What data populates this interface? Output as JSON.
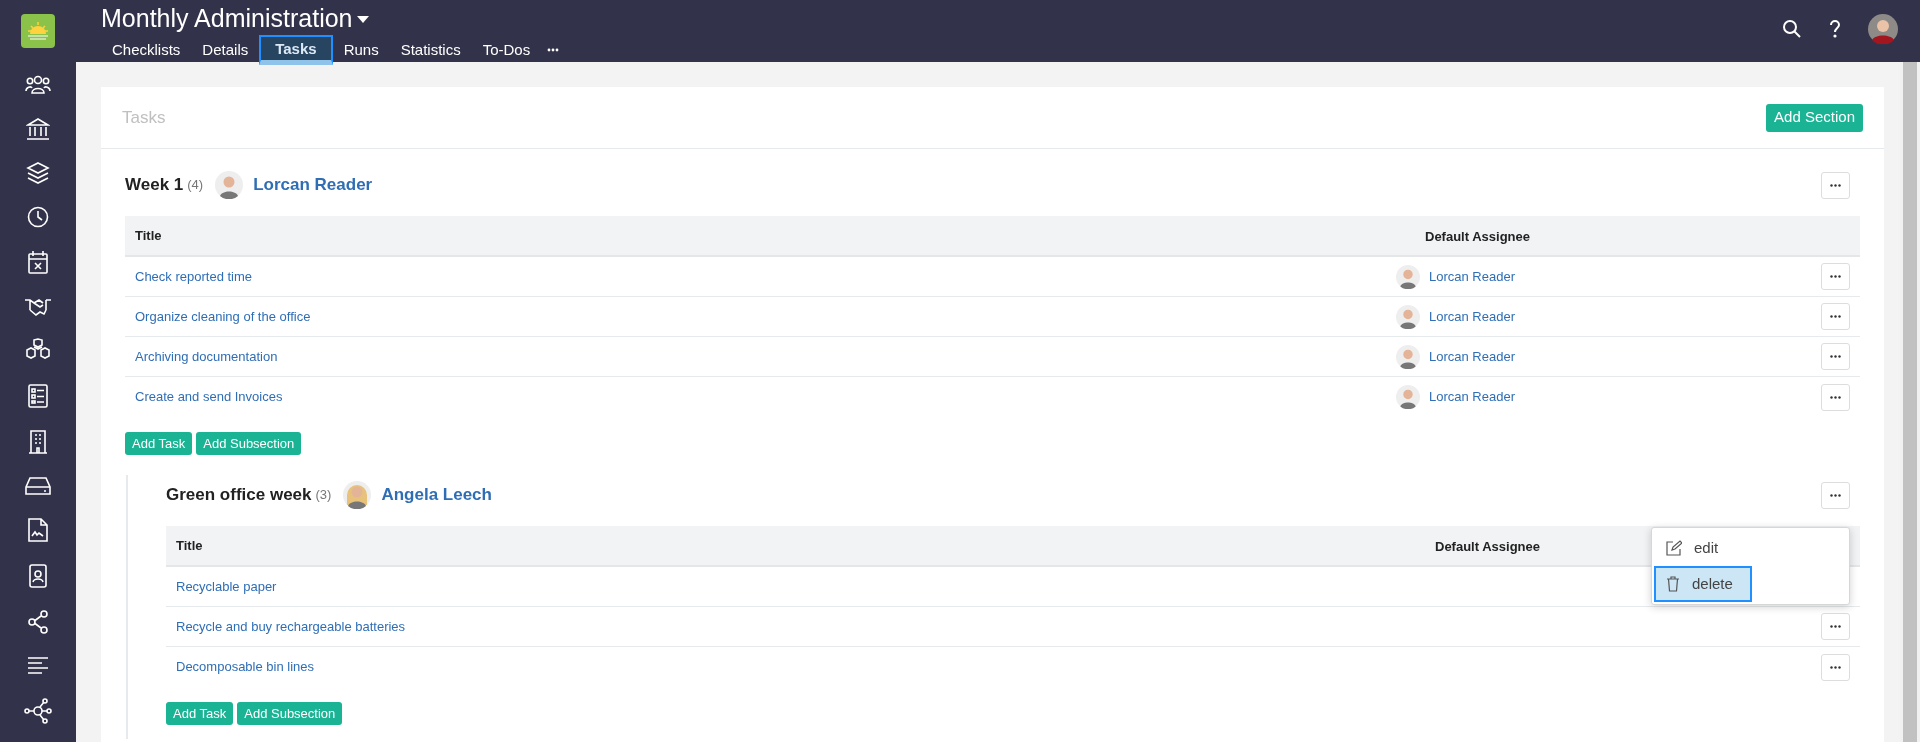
{
  "header": {
    "title": "Monthly Administration",
    "tabs": [
      {
        "label": "Checklists",
        "selected": false
      },
      {
        "label": "Details",
        "selected": false
      },
      {
        "label": "Tasks",
        "selected": true
      },
      {
        "label": "Runs",
        "selected": false
      },
      {
        "label": "Statistics",
        "selected": false
      },
      {
        "label": "To-Dos",
        "selected": false
      }
    ]
  },
  "panel": {
    "title": "Tasks",
    "add_section_button": "Add Section"
  },
  "sections": [
    {
      "title": "Week 1",
      "count": "(4)",
      "assignee": "Lorcan Reader",
      "nested": false,
      "columns": [
        "Title",
        "Default Assignee"
      ],
      "rows": [
        {
          "title": "Check reported time",
          "assignee": "Lorcan Reader"
        },
        {
          "title": "Organize cleaning of the office",
          "assignee": "Lorcan Reader"
        },
        {
          "title": "Archiving documentation",
          "assignee": "Lorcan Reader"
        },
        {
          "title": "Create and send Invoices",
          "assignee": "Lorcan Reader"
        }
      ],
      "buttons": [
        "Add Task",
        "Add Subsection"
      ]
    },
    {
      "title": "Green office week",
      "count": "(3)",
      "assignee": "Angela Leech",
      "nested": true,
      "columns": [
        "Title",
        "Default Assignee"
      ],
      "rows": [
        {
          "title": "Recyclable paper"
        },
        {
          "title": "Recycle and buy rechargeable batteries"
        },
        {
          "title": "Decomposable bin lines"
        }
      ],
      "buttons": [
        "Add Task",
        "Add Subsection"
      ],
      "menu": [
        {
          "label": "edit",
          "kind": "edit",
          "selected": false
        },
        {
          "label": "delete",
          "kind": "delete",
          "selected": true
        }
      ]
    }
  ]
}
